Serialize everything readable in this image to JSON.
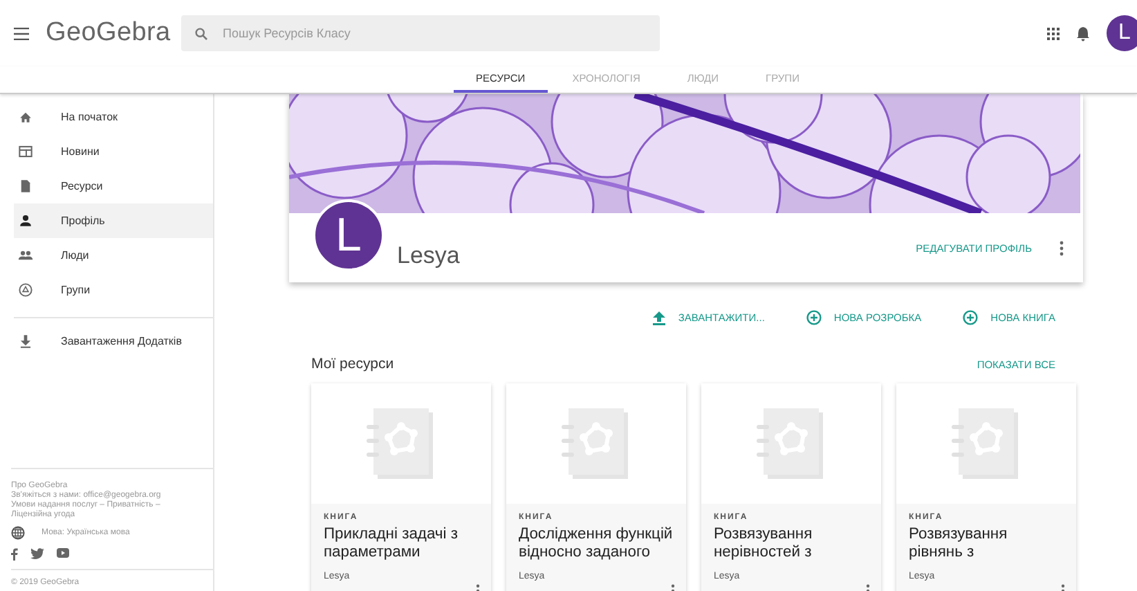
{
  "header": {
    "logo": "GeoGebra",
    "search": {
      "placeholder": "Пошук Ресурсів Класу"
    },
    "avatar_letter": "L"
  },
  "tabs": [
    {
      "label": "РЕСУРСИ",
      "selected": true
    },
    {
      "label": "ХРОНОЛОГІЯ",
      "selected": false
    },
    {
      "label": "ЛЮДИ",
      "selected": false
    },
    {
      "label": "ГРУПИ",
      "selected": false
    }
  ],
  "sidebar": {
    "items": [
      {
        "label": "На початок",
        "kind": "home",
        "selected": false
      },
      {
        "label": "Новини",
        "kind": "news",
        "selected": false
      },
      {
        "label": "Ресурси",
        "kind": "file",
        "selected": false
      },
      {
        "label": "Профіль",
        "kind": "person",
        "selected": true
      },
      {
        "label": "Люди",
        "kind": "people",
        "selected": false
      },
      {
        "label": "Групи",
        "kind": "group",
        "selected": false
      }
    ],
    "download": "Завантаження Додатків",
    "footer": {
      "lines": [
        "Про GeoGebra",
        "Зв'яжіться з нами: office@geogebra.org",
        "Умови надання послуг – Приватність –",
        "Ліцензійна угода"
      ],
      "language": "Мова: Українська мова",
      "copyright": "© 2019 GeoGebra"
    }
  },
  "profile": {
    "avatar_letter": "L",
    "name": "Lesya",
    "edit": "РЕДАГУВАТИ ПРОФІЛЬ"
  },
  "actions": [
    {
      "label": "ЗАВАНТАЖИТИ...",
      "kind": "upload"
    },
    {
      "label": "НОВА РОЗРОБКА",
      "kind": "add"
    },
    {
      "label": "НОВА КНИГА",
      "kind": "add"
    }
  ],
  "resources": {
    "title": "Мої ресурси",
    "show_all": "ПОКАЗАТИ ВСЕ",
    "cards": [
      {
        "type": "КНИГА",
        "title": "Прикладні задачі з параметрами",
        "author": "Lesya"
      },
      {
        "type": "КНИГА",
        "title": "Дослідження функцій відносно заданого",
        "author": "Lesya"
      },
      {
        "type": "КНИГА",
        "title": "Розвязування нерівностей з",
        "author": "Lesya"
      },
      {
        "type": "КНИГА",
        "title": "Розвязування рівнянь з",
        "author": "Lesya"
      }
    ]
  }
}
